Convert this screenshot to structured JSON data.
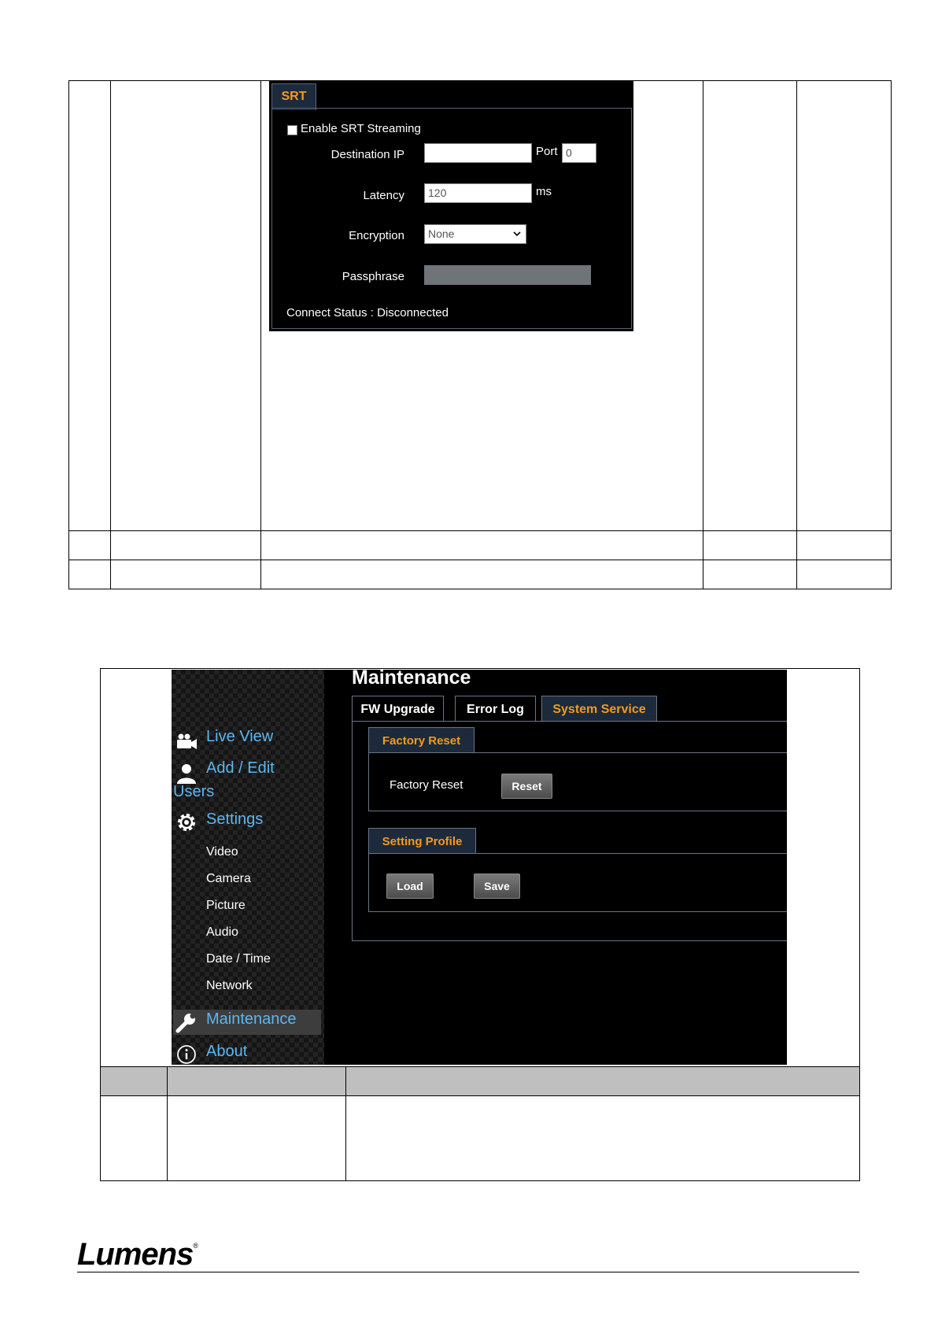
{
  "srt": {
    "tab_label": "SRT",
    "enable_label": "Enable SRT Streaming",
    "destination_ip_label": "Destination IP",
    "destination_ip_value": "",
    "port_label": "Port",
    "port_value": "0",
    "latency_label": "Latency",
    "latency_value": "120",
    "latency_unit": "ms",
    "encryption_label": "Encryption",
    "encryption_value": "None",
    "passphrase_label": "Passphrase",
    "passphrase_value": "",
    "status_text": "Connect Status : Disconnected"
  },
  "maintenance": {
    "title": "Maintenance",
    "tabs": [
      "FW Upgrade",
      "Error Log",
      "System Service"
    ],
    "active_tab": "System Service",
    "factory_reset_group": "Factory Reset",
    "factory_reset_label": "Factory Reset",
    "reset_button": "Reset",
    "setting_profile_group": "Setting Profile",
    "load_button": "Load",
    "save_button": "Save",
    "sidebar": {
      "live_view": "Live View",
      "add_edit": "Add / Edit",
      "users": "Users",
      "settings": "Settings",
      "sub_items": [
        "Video",
        "Camera",
        "Picture",
        "Audio",
        "Date / Time",
        "Network"
      ],
      "maintenance": "Maintenance",
      "about": "About"
    }
  },
  "footer": {
    "logo": "Lumens",
    "registered": "®"
  },
  "colors": {
    "accent_orange": "#f29a1f",
    "nav_blue": "#5bb7f0",
    "table_header_gray": "#bfbfbf"
  }
}
